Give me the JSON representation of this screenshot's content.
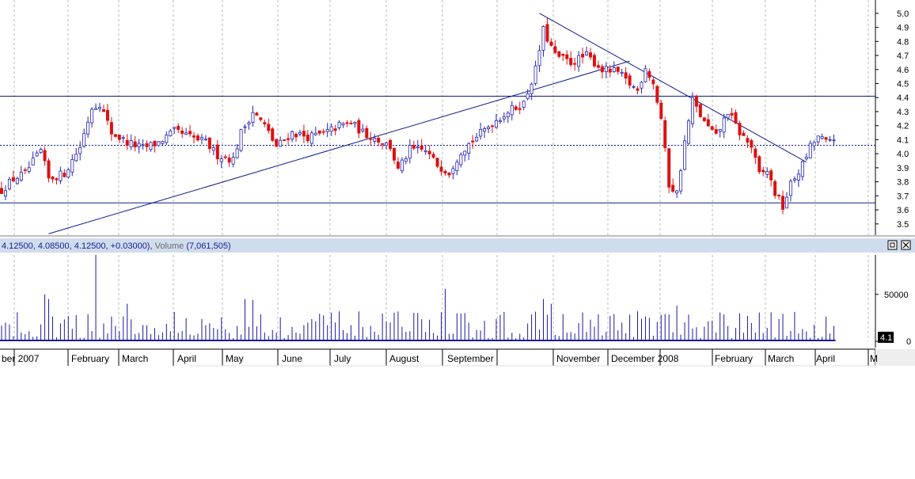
{
  "chart_data": [
    {
      "type": "candlestick",
      "title": "",
      "ohlc_readout": "4.12500, 4.08500, 4.12500, +0.03000)",
      "volume_readout_label": "Volume",
      "volume_readout_value": "(7,061,505)",
      "y_ticks": [
        3.5,
        3.6,
        3.7,
        3.8,
        3.9,
        4.0,
        4.1,
        4.2,
        4.3,
        4.4,
        4.5,
        4.6,
        4.7,
        4.8,
        4.9,
        5.0
      ],
      "ylim": [
        3.42,
        5.05
      ],
      "x_axis_labels": [
        "ber 2007",
        "February",
        "March",
        "April",
        "May",
        "June",
        "July",
        "August",
        "September",
        "November",
        "December 2008",
        "February",
        "March",
        "April",
        "M"
      ],
      "resistance_line": 4.41,
      "support_line": 3.65,
      "dotted_reference": 4.06,
      "uptrend_line": [
        {
          "day": 12,
          "price": 3.43
        },
        {
          "day": 160,
          "price": 4.66
        }
      ],
      "downtrend_line": [
        {
          "day": 137,
          "price": 5.0
        },
        {
          "day": 205,
          "price": 3.94
        }
      ],
      "close_path": [
        {
          "day": 0,
          "price": 3.74
        },
        {
          "day": 3,
          "price": 3.82
        },
        {
          "day": 6,
          "price": 3.86
        },
        {
          "day": 10,
          "price": 4.02
        },
        {
          "day": 12,
          "price": 3.82
        },
        {
          "day": 16,
          "price": 3.86
        },
        {
          "day": 20,
          "price": 4.05
        },
        {
          "day": 23,
          "price": 4.33
        },
        {
          "day": 25,
          "price": 4.36
        },
        {
          "day": 28,
          "price": 4.15
        },
        {
          "day": 32,
          "price": 4.08
        },
        {
          "day": 36,
          "price": 4.04
        },
        {
          "day": 40,
          "price": 4.08
        },
        {
          "day": 44,
          "price": 4.16
        },
        {
          "day": 48,
          "price": 4.12
        },
        {
          "day": 52,
          "price": 4.08
        },
        {
          "day": 55,
          "price": 3.99
        },
        {
          "day": 59,
          "price": 3.96
        },
        {
          "day": 61,
          "price": 4.15
        },
        {
          "day": 64,
          "price": 4.3
        },
        {
          "day": 67,
          "price": 4.2
        },
        {
          "day": 70,
          "price": 4.05
        },
        {
          "day": 74,
          "price": 4.15
        },
        {
          "day": 78,
          "price": 4.12
        },
        {
          "day": 82,
          "price": 4.14
        },
        {
          "day": 86,
          "price": 4.2
        },
        {
          "day": 89,
          "price": 4.22
        },
        {
          "day": 92,
          "price": 4.15
        },
        {
          "day": 96,
          "price": 4.1
        },
        {
          "day": 99,
          "price": 4.05
        },
        {
          "day": 101,
          "price": 3.88
        },
        {
          "day": 104,
          "price": 4.03
        },
        {
          "day": 108,
          "price": 4.02
        },
        {
          "day": 111,
          "price": 3.92
        },
        {
          "day": 114,
          "price": 3.87
        },
        {
          "day": 117,
          "price": 4.02
        },
        {
          "day": 121,
          "price": 4.12
        },
        {
          "day": 125,
          "price": 4.22
        },
        {
          "day": 129,
          "price": 4.3
        },
        {
          "day": 133,
          "price": 4.36
        },
        {
          "day": 136,
          "price": 4.6
        },
        {
          "day": 138,
          "price": 4.88
        },
        {
          "day": 141,
          "price": 4.7
        },
        {
          "day": 145,
          "price": 4.65
        },
        {
          "day": 149,
          "price": 4.7
        },
        {
          "day": 153,
          "price": 4.6
        },
        {
          "day": 157,
          "price": 4.58
        },
        {
          "day": 159,
          "price": 4.52
        },
        {
          "day": 162,
          "price": 4.45
        },
        {
          "day": 164,
          "price": 4.62
        },
        {
          "day": 166,
          "price": 4.5
        },
        {
          "day": 168,
          "price": 4.25
        },
        {
          "day": 170,
          "price": 3.78
        },
        {
          "day": 172,
          "price": 3.72
        },
        {
          "day": 174,
          "price": 4.08
        },
        {
          "day": 176,
          "price": 4.38
        },
        {
          "day": 179,
          "price": 4.22
        },
        {
          "day": 182,
          "price": 4.12
        },
        {
          "day": 185,
          "price": 4.3
        },
        {
          "day": 188,
          "price": 4.15
        },
        {
          "day": 191,
          "price": 4.05
        },
        {
          "day": 193,
          "price": 3.85
        },
        {
          "day": 195,
          "price": 3.88
        },
        {
          "day": 197,
          "price": 3.72
        },
        {
          "day": 199,
          "price": 3.62
        },
        {
          "day": 201,
          "price": 3.78
        },
        {
          "day": 204,
          "price": 3.92
        },
        {
          "day": 206,
          "price": 4.05
        },
        {
          "day": 208,
          "price": 4.12
        },
        {
          "day": 210,
          "price": 4.08
        },
        {
          "day": 212,
          "price": 4.12
        }
      ],
      "volume": {
        "y_ticks": [
          0,
          50000
        ],
        "ylim": [
          0,
          92000
        ],
        "current_value_tag": "4.1",
        "spikes": [
          {
            "day": 11,
            "value": 50000
          },
          {
            "day": 12,
            "value": 45000
          },
          {
            "day": 24,
            "value": 92000
          },
          {
            "day": 32,
            "value": 40000
          },
          {
            "day": 62,
            "value": 45000
          },
          {
            "day": 64,
            "value": 44000
          },
          {
            "day": 113,
            "value": 56000
          },
          {
            "day": 138,
            "value": 45000
          },
          {
            "day": 140,
            "value": 40000
          },
          {
            "day": 172,
            "value": 38000
          }
        ]
      },
      "colors": {
        "up": "#2222bb",
        "down": "#dd1111",
        "lines": "#0a1a8c",
        "grid": "#b8b8b8",
        "volume": "#1a1aa0",
        "header_bg": "#cfdcec",
        "header_text": "#1a1a9a",
        "header_label": "#6a6a6a"
      }
    }
  ]
}
